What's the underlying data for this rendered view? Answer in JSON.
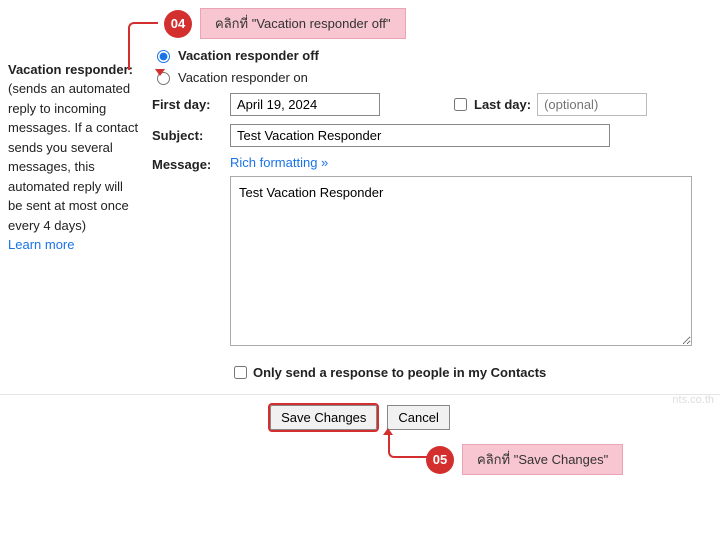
{
  "callout04": {
    "num": "04",
    "text": "คลิกที่ \"Vacation responder off\""
  },
  "callout05": {
    "num": "05",
    "text": "คลิกที่ \"Save Changes\""
  },
  "sidebar": {
    "title": "Vacation responder:",
    "desc": "(sends an automated reply to incoming messages. If a contact sends you several messages, this automated reply will be sent at most once every 4 days)",
    "learn": "Learn more"
  },
  "radio": {
    "off": "Vacation responder off",
    "on": "Vacation responder on"
  },
  "first_day": {
    "label": "First day:",
    "value": "April 19, 2024"
  },
  "last_day": {
    "label": "Last day:",
    "placeholder": "(optional)"
  },
  "subject": {
    "label": "Subject:",
    "value": "Test Vacation Responder"
  },
  "message": {
    "label": "Message:",
    "rich": "Rich formatting »",
    "value": "Test Vacation Responder"
  },
  "only_contacts": "Only send a response to people in my Contacts",
  "buttons": {
    "save": "Save Changes",
    "cancel": "Cancel"
  },
  "watermark": "nts.co.th"
}
